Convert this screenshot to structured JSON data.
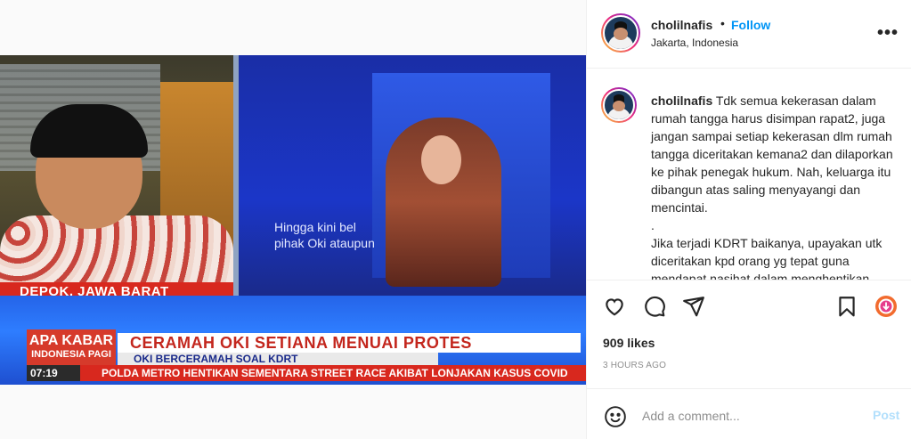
{
  "post": {
    "username": "cholilnafis",
    "follow_label": "Follow",
    "separator": "•",
    "location": "Jakarta, Indonesia",
    "more_label": "•••",
    "caption_lines": [
      "Tdk semua kekerasan dalam rumah tangga harus disimpan rapat2, juga jangan sampai setiap kekerasan dlm rumah tangga diceritakan kemana2 dan dilaporkan ke pihak penegak hukum. Nah, keluarga itu dibangun atas saling menyayangi dan mencintai.",
      ".",
      "Jika terjadi KDRT baikanya, upayakan utk diceritakan kpd orang yg tepat guna mendapat nasihat dalam menghentikan"
    ],
    "likes": "909 likes",
    "time_ago": "3 HOURS AGO",
    "comment_placeholder": "Add a comment...",
    "post_label": "Post"
  },
  "image": {
    "location_caption": "DEPOK, JAWA BARAT",
    "subtitle_line1": "Hingga kini bel",
    "subtitle_line2": "pihak Oki ataupun",
    "headline": "CERAMAH OKI SETIANA MENUAI PROTES",
    "subheadline": "OKI BERCERAMAH SOAL KDRT",
    "program_logo": "APA KABAR",
    "program_logo_sub": "INDONESIA PAGI",
    "clock": "07:19",
    "crawl": "POLDA METRO HENTIKAN SEMENTARA STREET RACE AKIBAT LONJAKAN KASUS COVID"
  },
  "icons": {
    "like": "heart-icon",
    "comment": "comment-icon",
    "share": "share-icon",
    "save": "bookmark-icon",
    "extra": "download-icon",
    "emoji": "emoji-icon",
    "more": "more-icon"
  },
  "colors": {
    "follow": "#0095f6",
    "post_disabled": "#b2dffc",
    "muted": "#8e8e8e",
    "tv_red": "#d8281e",
    "tv_blue": "#2564e8"
  }
}
